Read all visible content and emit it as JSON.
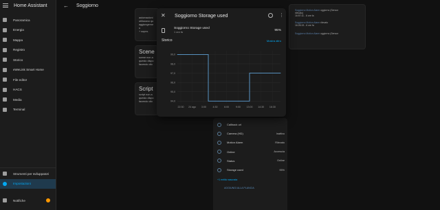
{
  "sidebar": {
    "title": "Home Assistant",
    "items": [
      {
        "label": "Panoramica",
        "icon": "dashboard-icon"
      },
      {
        "label": "Energia",
        "icon": "energy-icon"
      },
      {
        "label": "Mappa",
        "icon": "map-icon"
      },
      {
        "label": "Registro",
        "icon": "logbook-icon"
      },
      {
        "label": "Storico",
        "icon": "history-icon"
      },
      {
        "label": "eWeLink Smart Home",
        "icon": "ewelink-icon"
      },
      {
        "label": "File editor",
        "icon": "file-editor-icon"
      },
      {
        "label": "HACS",
        "icon": "hacs-icon"
      },
      {
        "label": "Media",
        "icon": "media-icon"
      },
      {
        "label": "Terminal",
        "icon": "terminal-icon"
      }
    ],
    "bottom": [
      {
        "label": "Strumenti per sviluppatori",
        "icon": "developer-tools-icon"
      },
      {
        "label": "Impostazioni",
        "icon": "settings-icon"
      },
      {
        "label": "Notifiche",
        "icon": "bell-icon"
      }
    ]
  },
  "topbar": {
    "title": "Soggiorno",
    "back": "←"
  },
  "bg_cards": {
    "card1_title": "",
    "card1_lines": [
      "automazioni",
      "utilizzano qu",
      "aggiungerne u",
      "+ sopra."
    ],
    "scene_title": "Scene",
    "scene_lines": [
      "scene non a",
      "questo dispo",
      "facendo clic"
    ],
    "script_title": "Script",
    "script_lines": [
      "script non a",
      "questo dispo",
      "facendo clic"
    ]
  },
  "logbook": [
    {
      "entity": "Soggiorno Motion Alarm",
      "text": "oggiorno (Sensor",
      "extra": "rilevato)",
      "time": "16:57:11 - 6 ore fa"
    },
    {
      "entity": "Soggiorno Motion Alarm",
      "text": "rilevato",
      "extra": "",
      "time": "16:26:15 - 6 ore fa"
    },
    {
      "entity": "Soggiorno Motion Alarm",
      "text": "oggiorno (Sensor",
      "extra": "",
      "time": ""
    }
  ],
  "attributes": {
    "rows": [
      {
        "label": "Callback url",
        "value": "",
        "icon": "link-icon"
      },
      {
        "label": "Camera (HD)",
        "value": "Inattivo",
        "icon": "camera-icon"
      },
      {
        "label": "Motion Alarm",
        "value": "Rilevato",
        "icon": "motion-icon"
      },
      {
        "label": "Online",
        "value": "Acceso/a",
        "icon": "online-icon"
      },
      {
        "label": "Status",
        "value": "Online",
        "icon": "status-icon"
      },
      {
        "label": "Storage used",
        "value": "95%",
        "icon": "sd-card-icon"
      }
    ],
    "link_more": "+1 entità nascosta",
    "add_to_dashboard": "AGGIUNGI ALLA PLANCIA"
  },
  "dialog": {
    "title": "Soggiorno Storage used",
    "close": "✕",
    "more": "⋮",
    "entity_name": "Soggiorno Storage used",
    "entity_sub": "1 ora fa",
    "entity_value": "95%",
    "section": "Storico",
    "section_link": "Mostra altro"
  },
  "chart_data": {
    "type": "line",
    "series": [
      {
        "values": [
          99,
          99,
          99,
          94,
          94,
          94,
          94,
          97,
          97,
          97,
          97
        ]
      }
    ],
    "x": [
      "22:30",
      "24 ago",
      "3:00",
      "4:30",
      "6:00",
      "9:00",
      "10:30",
      "13:00",
      "14:30",
      "15:30",
      "16:30"
    ],
    "x_tick_labels": [
      "22:30",
      "24 ago",
      "3:00",
      "4:30",
      "6:00",
      "9:00",
      "13:00",
      "14:30",
      "16:30"
    ],
    "y_tick_labels": [
      "99,0",
      "98,0",
      "97,0",
      "96,0",
      "95,0",
      "94,0"
    ],
    "ylim": [
      93.8,
      99.4
    ],
    "line_color": "#5fa1d5",
    "grid": true,
    "title": "",
    "xlabel": "",
    "ylabel": ""
  }
}
